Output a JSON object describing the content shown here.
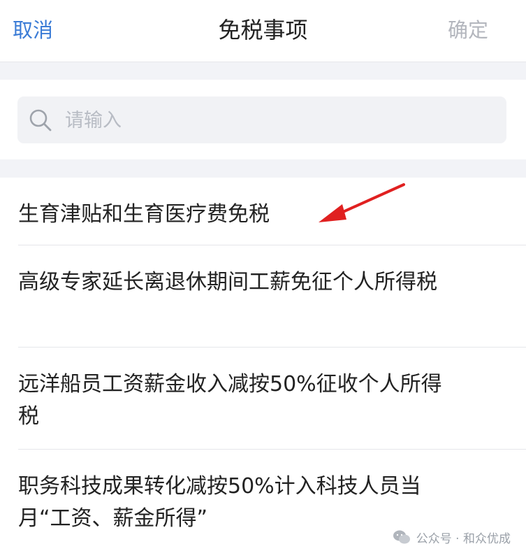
{
  "header": {
    "cancel": "取消",
    "title": "免税事项",
    "confirm": "确定"
  },
  "search": {
    "placeholder": "请输入",
    "value": ""
  },
  "items": [
    {
      "label": "生育津贴和生育医疗费免税"
    },
    {
      "label": "高级专家延长离退休期间工薪免征个人所得税"
    },
    {
      "label": "远洋船员工资薪金收入减按50%征收个人所得税"
    },
    {
      "label": "职务科技成果转化减按50%计入科技人员当月“工资、薪金所得”"
    }
  ],
  "watermark": {
    "text": "公众号 · 和众优成"
  },
  "colors": {
    "accent": "#3b7cd6",
    "disabled": "#b3b6bd",
    "arrow": "#e02020"
  },
  "icons": [
    "search-icon",
    "red-arrow-annotation-icon",
    "wechat-logo-icon"
  ]
}
